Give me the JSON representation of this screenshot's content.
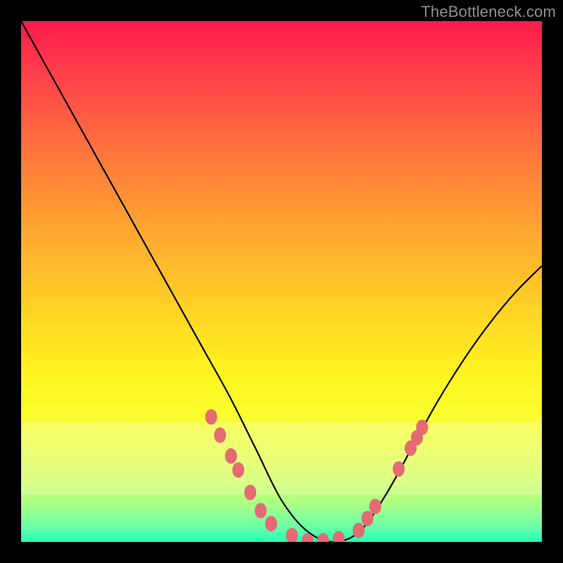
{
  "watermark": "TheBottleneck.com",
  "chart_data": {
    "type": "line",
    "title": "",
    "xlabel": "",
    "ylabel": "",
    "xlim": [
      0,
      100
    ],
    "ylim": [
      0,
      100
    ],
    "series": [
      {
        "name": "curve",
        "x": [
          0,
          5,
          10,
          15,
          20,
          25,
          30,
          35,
          40,
          45,
          50,
          55,
          60,
          65,
          70,
          75,
          80,
          85,
          90,
          95,
          100
        ],
        "values": [
          100,
          91,
          82,
          73,
          64,
          55,
          46,
          37,
          28,
          18,
          8,
          2,
          0,
          2,
          9,
          18,
          27,
          35,
          42,
          48,
          53
        ]
      }
    ],
    "highlight_band_y": [
      9,
      23
    ],
    "markers": {
      "name": "dots",
      "color": "#e46a74",
      "points": [
        {
          "x": 36.5,
          "y": 24.0
        },
        {
          "x": 38.2,
          "y": 20.5
        },
        {
          "x": 40.3,
          "y": 16.5
        },
        {
          "x": 41.7,
          "y": 13.8
        },
        {
          "x": 44.0,
          "y": 9.5
        },
        {
          "x": 46.0,
          "y": 6.0
        },
        {
          "x": 48.0,
          "y": 3.5
        },
        {
          "x": 52.0,
          "y": 1.2
        },
        {
          "x": 55.0,
          "y": 0.2
        },
        {
          "x": 58.0,
          "y": 0.2
        },
        {
          "x": 61.0,
          "y": 0.6
        },
        {
          "x": 64.8,
          "y": 2.2
        },
        {
          "x": 66.5,
          "y": 4.5
        },
        {
          "x": 68.0,
          "y": 6.8
        },
        {
          "x": 72.5,
          "y": 14.0
        },
        {
          "x": 74.8,
          "y": 18.0
        },
        {
          "x": 76.0,
          "y": 20.0
        },
        {
          "x": 77.0,
          "y": 22.0
        }
      ]
    },
    "gradient_stops": [
      {
        "pos": 0,
        "color": "#ff1a4d"
      },
      {
        "pos": 50,
        "color": "#ffd226"
      },
      {
        "pos": 75,
        "color": "#fcff2c"
      },
      {
        "pos": 100,
        "color": "#24ffb7"
      }
    ]
  }
}
